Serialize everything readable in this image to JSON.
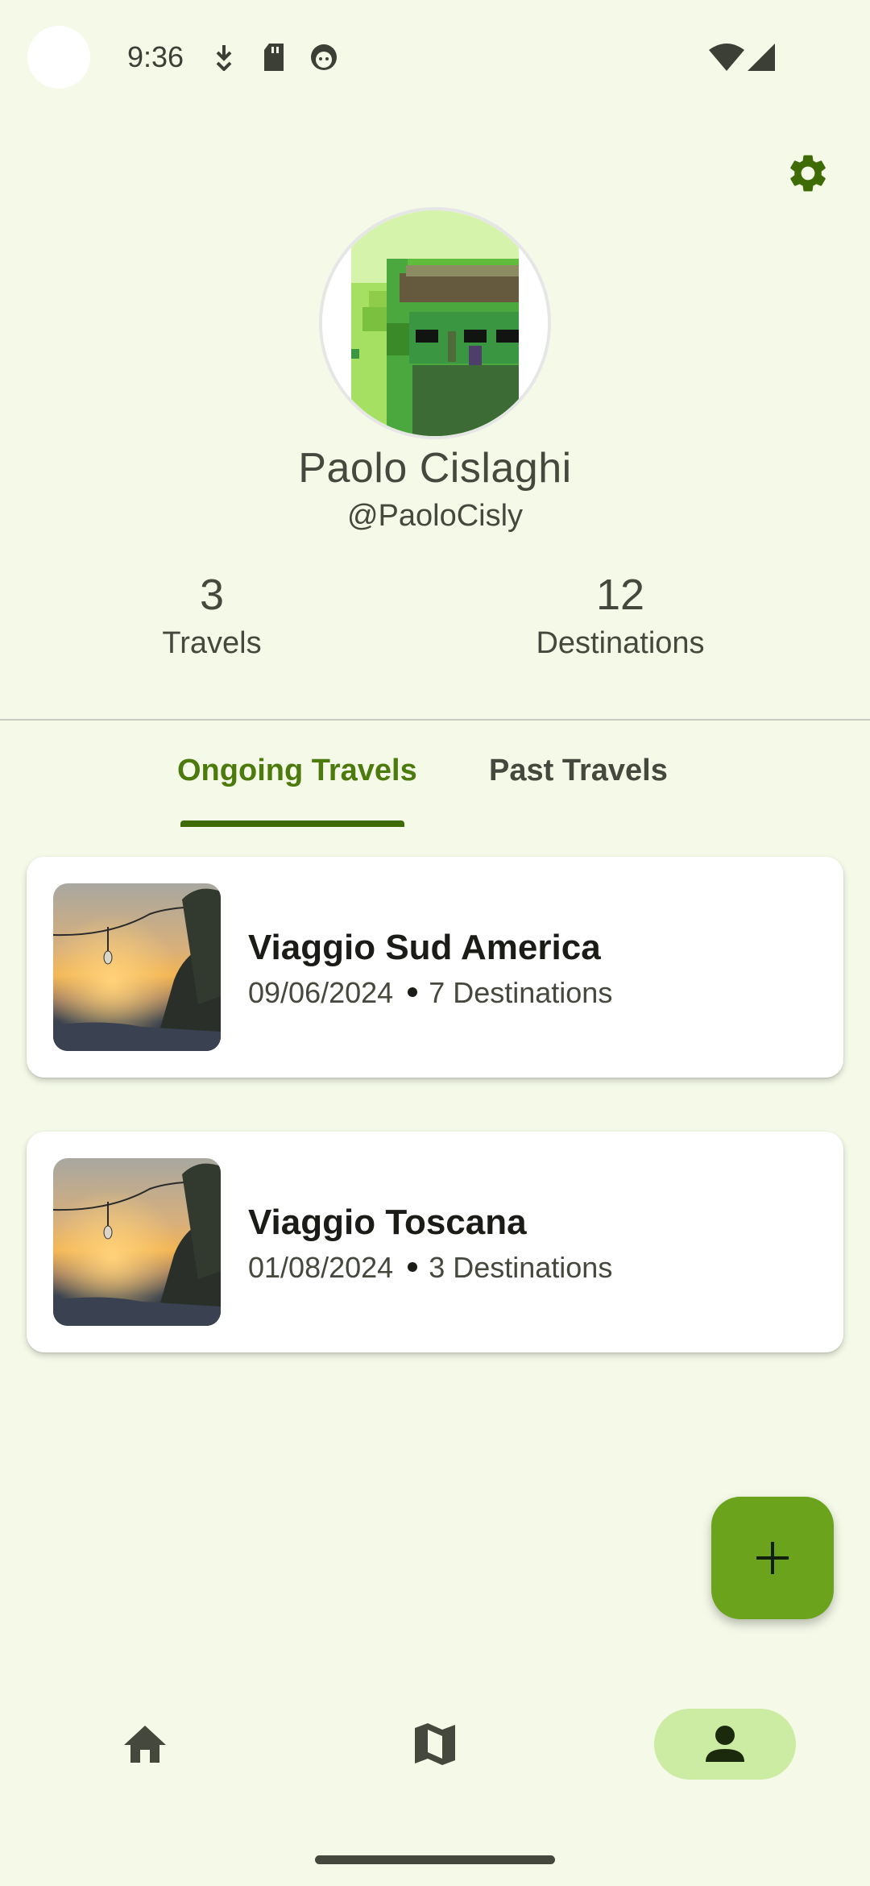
{
  "status_bar": {
    "time": "9:36",
    "icons": [
      "download-icon",
      "sd-card-icon",
      "face-icon",
      "wifi-icon",
      "signal-icon"
    ]
  },
  "header": {
    "settings_icon": "gear-icon"
  },
  "profile": {
    "name": "Paolo  Cislaghi",
    "handle": "@PaoloCisly",
    "stats": [
      {
        "value": "3",
        "label": "Travels"
      },
      {
        "value": "12",
        "label": "Destinations"
      }
    ]
  },
  "tabs": [
    {
      "label": "Ongoing Travels",
      "active": true
    },
    {
      "label": "Past Travels",
      "active": false
    }
  ],
  "travels": [
    {
      "title": "Viaggio Sud America",
      "date": "09/06/2024",
      "destinations": "7 Destinations"
    },
    {
      "title": "Viaggio Toscana",
      "date": "01/08/2024",
      "destinations": "3 Destinations"
    }
  ],
  "fab": {
    "icon": "plus-icon"
  },
  "bottom_nav": [
    {
      "icon": "home-icon",
      "active": false
    },
    {
      "icon": "map-icon",
      "active": false
    },
    {
      "icon": "person-icon",
      "active": true
    }
  ],
  "colors": {
    "background": "#f4f9e8",
    "accent": "#4c7a0c",
    "fab": "#6ba31d",
    "nav_active": "#cdeca3"
  }
}
